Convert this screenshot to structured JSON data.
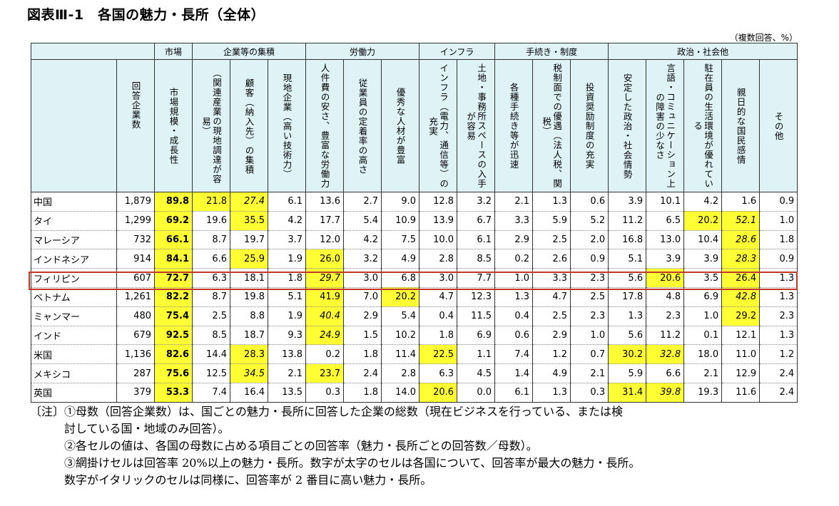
{
  "title": "図表Ⅲ-1　各国の魅力・長所（全体）",
  "unit_note": "（複数回答、%）",
  "groups": [
    {
      "label": "市場",
      "span": 1
    },
    {
      "label": "企業等の集積",
      "span": 3
    },
    {
      "label": "労働力",
      "span": 3
    },
    {
      "label": "インフラ",
      "span": 2
    },
    {
      "label": "手続き・制度",
      "span": 3
    },
    {
      "label": "政治・社会他",
      "span": 5
    }
  ],
  "count_header": "回答企業数",
  "columns": [
    "市場規模・成長性",
    "（関連産業の現地調達が容易）",
    "顧客（納入先）の集積",
    "現地企業（高い技術力）",
    "人件費の安さ、豊富な労働力",
    "従業員の定着率の高さ",
    "優秀な人材が豊富",
    "インフラ（電力、通信等）の充実",
    "土地・事務所スペースの入手が容易",
    "各種手続き等が迅速",
    "税制面での優遇（法人税、関税）",
    "投資奨励制度の充実",
    "安定した政治・社会情勢",
    "言語・コミュニケーション上の障害の少なさ",
    "駐在員の生活環境が優れている",
    "親日的な国民感情",
    "その他"
  ],
  "rows": [
    {
      "country": "中国",
      "count": "1,879",
      "values": [
        "89.8",
        "21.8",
        "27.4",
        "6.1",
        "13.6",
        "2.7",
        "9.0",
        "12.8",
        "3.2",
        "2.1",
        "1.3",
        "0.6",
        "3.9",
        "10.1",
        "4.2",
        "1.6",
        "0.9"
      ]
    },
    {
      "country": "タイ",
      "count": "1,299",
      "values": [
        "69.2",
        "19.6",
        "35.5",
        "4.2",
        "17.7",
        "5.4",
        "10.9",
        "13.9",
        "6.7",
        "3.3",
        "5.9",
        "5.2",
        "11.2",
        "6.5",
        "20.2",
        "52.1",
        "1.0"
      ]
    },
    {
      "country": "マレーシア",
      "count": "732",
      "values": [
        "66.1",
        "8.7",
        "19.7",
        "3.7",
        "12.0",
        "4.2",
        "7.5",
        "10.0",
        "6.1",
        "2.9",
        "2.5",
        "2.0",
        "16.8",
        "13.0",
        "10.4",
        "28.6",
        "1.8"
      ]
    },
    {
      "country": "インドネシア",
      "count": "914",
      "values": [
        "84.1",
        "6.6",
        "25.9",
        "1.9",
        "26.0",
        "3.2",
        "4.9",
        "2.8",
        "8.5",
        "0.2",
        "2.6",
        "0.9",
        "5.1",
        "3.9",
        "3.9",
        "28.3",
        "0.9"
      ]
    },
    {
      "country": "フィリピン",
      "count": "607",
      "values": [
        "72.7",
        "6.3",
        "18.1",
        "1.8",
        "29.7",
        "3.0",
        "6.8",
        "3.0",
        "7.7",
        "1.0",
        "3.3",
        "2.3",
        "5.6",
        "20.6",
        "3.5",
        "26.4",
        "1.3"
      ]
    },
    {
      "country": "ベトナム",
      "count": "1,261",
      "values": [
        "82.2",
        "8.7",
        "19.8",
        "5.1",
        "41.9",
        "7.0",
        "20.2",
        "4.7",
        "12.3",
        "1.3",
        "4.7",
        "2.5",
        "17.8",
        "4.8",
        "6.9",
        "42.8",
        "1.3"
      ]
    },
    {
      "country": "ミャンマー",
      "count": "480",
      "values": [
        "75.4",
        "2.5",
        "8.8",
        "1.9",
        "40.4",
        "2.9",
        "5.4",
        "0.4",
        "11.5",
        "0.4",
        "2.5",
        "2.3",
        "1.3",
        "2.3",
        "1.0",
        "29.2",
        "2.3"
      ]
    },
    {
      "country": "インド",
      "count": "679",
      "values": [
        "92.5",
        "8.5",
        "18.7",
        "9.3",
        "24.9",
        "1.5",
        "10.2",
        "1.8",
        "6.9",
        "0.6",
        "2.9",
        "1.0",
        "5.6",
        "11.2",
        "0.1",
        "12.1",
        "1.3"
      ]
    },
    {
      "country": "米国",
      "count": "1,136",
      "values": [
        "82.6",
        "14.4",
        "28.3",
        "13.8",
        "0.2",
        "1.8",
        "11.4",
        "22.5",
        "1.1",
        "7.4",
        "1.2",
        "0.7",
        "30.2",
        "32.8",
        "18.0",
        "11.0",
        "1.2"
      ]
    },
    {
      "country": "メキシコ",
      "count": "287",
      "values": [
        "75.6",
        "12.5",
        "34.5",
        "2.1",
        "23.7",
        "2.4",
        "2.8",
        "6.3",
        "4.5",
        "1.4",
        "4.9",
        "2.1",
        "5.9",
        "6.6",
        "2.1",
        "12.9",
        "2.4"
      ]
    },
    {
      "country": "英国",
      "count": "379",
      "values": [
        "53.3",
        "7.4",
        "16.4",
        "13.5",
        "0.3",
        "1.8",
        "14.0",
        "20.6",
        "0.0",
        "6.1",
        "1.3",
        "0.3",
        "31.4",
        "39.8",
        "19.3",
        "11.6",
        "2.4"
      ]
    }
  ],
  "highlight_color": "#ffff33",
  "emphasis_color": "#c0392b",
  "notes": [
    "〔注〕①母数（回答企業数）は、国ごとの魅力・長所に回答した企業の総数（現在ビジネスを行っている、または検",
    "　　　討している国・地域のみ回答）。",
    "　　　②各セルの値は、各国の母数に占める項目ごとの回答率（魅力・長所ごとの回答数／母数）。",
    "　　　③網掛けセルは回答率 20%以上の魅力・長所。数字が太字のセルは各国について、回答率が最大の魅力・長所。",
    "　　　数字がイタリックのセルは同様に、回答率が 2 番目に高い魅力・長所。"
  ]
}
